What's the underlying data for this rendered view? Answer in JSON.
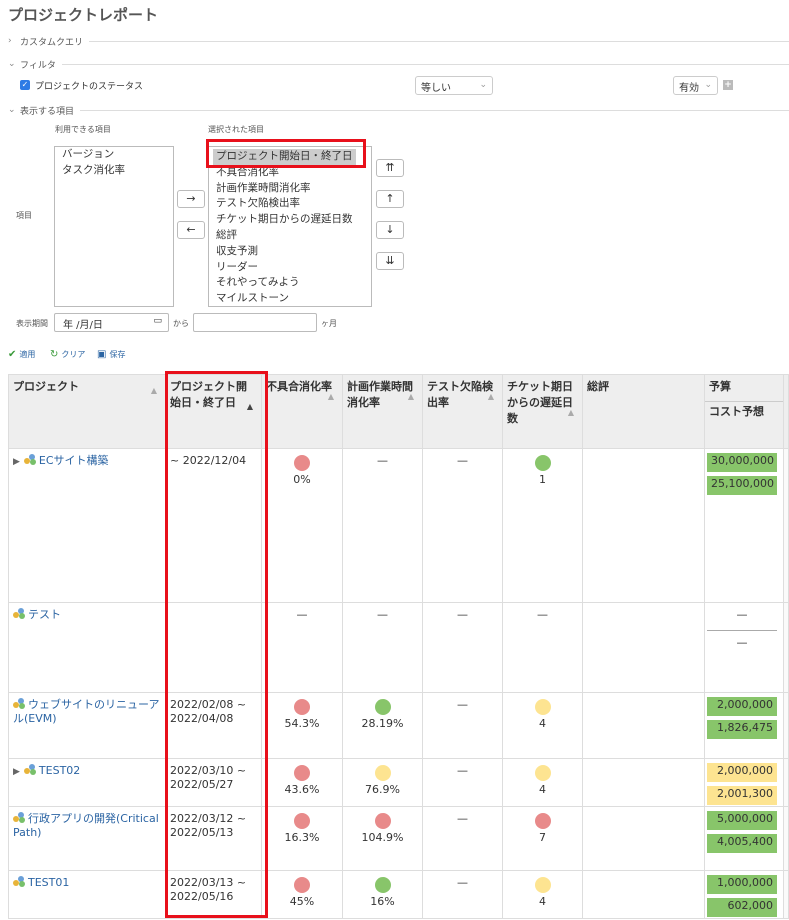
{
  "page": {
    "title": "プロジェクトレポート"
  },
  "sections": {
    "custom_query": "カスタムクエリ",
    "filter": "フィルタ",
    "display_items": "表示する項目"
  },
  "filter": {
    "label": "プロジェクトのステータス",
    "operator": "等しい",
    "value": "有効",
    "add": "+"
  },
  "columns_picker": {
    "available_label": "利用できる項目",
    "selected_label": "選択された項目",
    "row_label": "項目",
    "available": [
      "バージョン",
      "タスク消化率"
    ],
    "selected": [
      "プロジェクト開始日・終了日",
      "不具合消化率",
      "計画作業時間消化率",
      "テスト欠陥検出率",
      "チケット期日からの遅延日数",
      "総評",
      "収支予測",
      "リーダー",
      "それやってみよう",
      "マイルストーン"
    ],
    "move_right": "→",
    "move_left": "←",
    "top": "⇈",
    "up": "↑",
    "down": "↓",
    "bottom": "⇊"
  },
  "period": {
    "label": "表示期間",
    "date_placeholder": "年 /月/日",
    "from": "から",
    "months_unit": "ヶ月"
  },
  "actions": {
    "apply": "適用",
    "clear": "クリア",
    "save": "保存"
  },
  "table": {
    "headers": {
      "project": "プロジェクト",
      "dates": "プロジェクト開始日・終了日",
      "defect": "不具合消化率",
      "planned": "計画作業時間消化率",
      "test": "テスト欠陥検出率",
      "delay": "チケット期日からの遅延日数",
      "review": "総評",
      "budget": "予算",
      "cost": "コスト予想"
    },
    "rows": [
      {
        "name": "ECサイト構築",
        "expand": "▶",
        "dates": "~ 2022/12/04",
        "defect_pct": "0%",
        "planned_pct": "—",
        "test": "—",
        "delay_days": "1",
        "budget": "30,000,000",
        "cost": "25,100,000"
      },
      {
        "name": "テスト",
        "expand": "",
        "dates": "",
        "defect_pct": "—",
        "planned_pct": "—",
        "test": "—",
        "delay_days": "—",
        "budget": "—",
        "cost": "—"
      },
      {
        "name": "ウェブサイトのリニューアル(EVM)",
        "expand": "",
        "dates": "2022/02/08 ~ 2022/04/08",
        "defect_pct": "54.3%",
        "planned_pct": "28.19%",
        "test": "—",
        "delay_days": "4",
        "budget": "2,000,000",
        "cost": "1,826,475"
      },
      {
        "name": "TEST02",
        "expand": "▶",
        "dates": "2022/03/10 ~ 2022/05/27",
        "defect_pct": "43.6%",
        "planned_pct": "76.9%",
        "test": "—",
        "delay_days": "4",
        "budget": "2,000,000",
        "cost": "2,001,300"
      },
      {
        "name": "行政アプリの開発(Critical Path)",
        "expand": "",
        "dates": "2022/03/12 ~ 2022/05/13",
        "defect_pct": "16.3%",
        "planned_pct": "104.9%",
        "test": "—",
        "delay_days": "7",
        "budget": "5,000,000",
        "cost": "4,005,400"
      },
      {
        "name": "TEST01",
        "expand": "",
        "dates": "2022/03/13 ~ 2022/05/16",
        "defect_pct": "45%",
        "planned_pct": "16%",
        "test": "—",
        "delay_days": "4",
        "budget": "1,000,000",
        "cost": "602,000"
      }
    ]
  },
  "colors": {
    "red": "#e88a8a",
    "green": "#88c56a",
    "yellow": "#fde491",
    "highlight": "#e8101b",
    "link": "#2b64a3"
  }
}
